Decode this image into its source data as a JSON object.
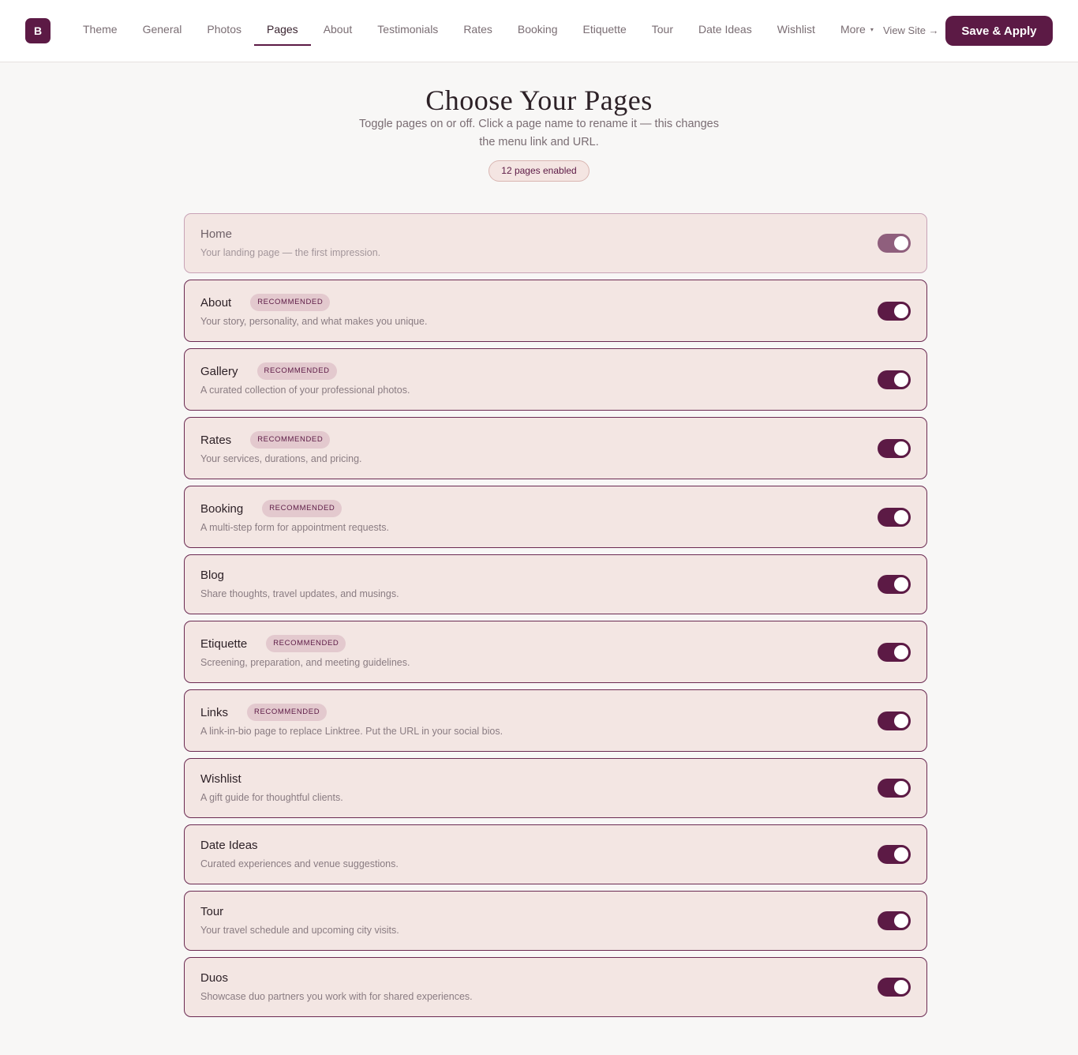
{
  "app": {
    "logo_letter": "B",
    "brand_color": "#5c1a45"
  },
  "nav": {
    "tabs": [
      {
        "label": "Theme",
        "active": false
      },
      {
        "label": "General",
        "active": false
      },
      {
        "label": "Photos",
        "active": false
      },
      {
        "label": "Pages",
        "active": true
      },
      {
        "label": "About",
        "active": false
      },
      {
        "label": "Testimonials",
        "active": false
      },
      {
        "label": "Rates",
        "active": false
      },
      {
        "label": "Booking",
        "active": false
      },
      {
        "label": "Etiquette",
        "active": false
      },
      {
        "label": "Tour",
        "active": false
      },
      {
        "label": "Date Ideas",
        "active": false
      },
      {
        "label": "Wishlist",
        "active": false
      },
      {
        "label": "More",
        "active": false,
        "dropdown": true
      }
    ],
    "view_site_label": "View Site →",
    "save_label": "Save & Apply"
  },
  "header": {
    "title": "Choose Your Pages",
    "subtitle": "Toggle pages on or off. Click a page name to rename it — this changes the menu link and URL.",
    "enabled_count_label": "12 pages enabled"
  },
  "pages": [
    {
      "name": "Home",
      "description": "Your landing page — the first impression.",
      "recommended": false,
      "enabled": true,
      "locked": true
    },
    {
      "name": "About",
      "description": "Your story, personality, and what makes you unique.",
      "recommended": true,
      "enabled": true,
      "locked": false
    },
    {
      "name": "Gallery",
      "description": "A curated collection of your professional photos.",
      "recommended": true,
      "enabled": true,
      "locked": false
    },
    {
      "name": "Rates",
      "description": "Your services, durations, and pricing.",
      "recommended": true,
      "enabled": true,
      "locked": false
    },
    {
      "name": "Booking",
      "description": "A multi-step form for appointment requests.",
      "recommended": true,
      "enabled": true,
      "locked": false
    },
    {
      "name": "Blog",
      "description": "Share thoughts, travel updates, and musings.",
      "recommended": false,
      "enabled": true,
      "locked": false
    },
    {
      "name": "Etiquette",
      "description": "Screening, preparation, and meeting guidelines.",
      "recommended": true,
      "enabled": true,
      "locked": false
    },
    {
      "name": "Links",
      "description": "A link-in-bio page to replace Linktree. Put the URL in your social bios.",
      "recommended": true,
      "enabled": true,
      "locked": false
    },
    {
      "name": "Wishlist",
      "description": "A gift guide for thoughtful clients.",
      "recommended": false,
      "enabled": true,
      "locked": false
    },
    {
      "name": "Date Ideas",
      "description": "Curated experiences and venue suggestions.",
      "recommended": false,
      "enabled": true,
      "locked": false
    },
    {
      "name": "Tour",
      "description": "Your travel schedule and upcoming city visits.",
      "recommended": false,
      "enabled": true,
      "locked": false
    },
    {
      "name": "Duos",
      "description": "Showcase duo partners you work with for shared experiences.",
      "recommended": false,
      "enabled": true,
      "locked": false
    }
  ],
  "badge_label": "RECOMMENDED"
}
